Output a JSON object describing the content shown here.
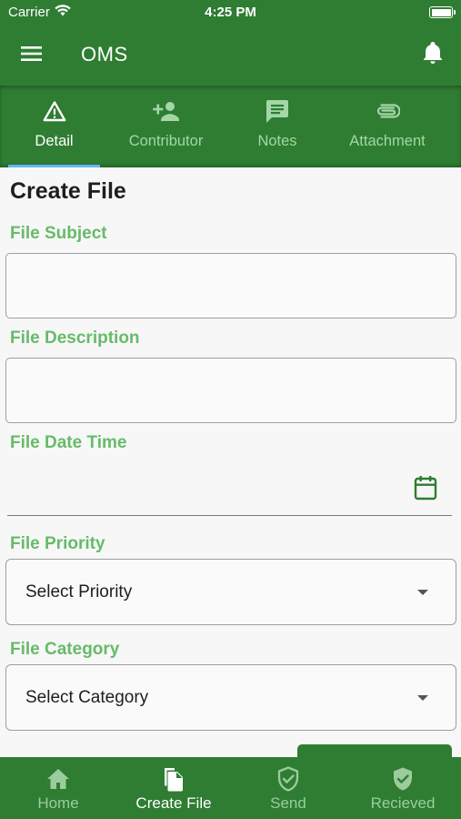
{
  "status_bar": {
    "carrier": "Carrier",
    "time": "4:25 PM"
  },
  "app_bar": {
    "title": "OMS"
  },
  "tabs": [
    {
      "label": "Detail",
      "icon": "warning-icon",
      "active": true
    },
    {
      "label": "Contributor",
      "icon": "person-add-icon",
      "active": false
    },
    {
      "label": "Notes",
      "icon": "comment-icon",
      "active": false
    },
    {
      "label": "Attachment",
      "icon": "paperclip-icon",
      "active": false
    }
  ],
  "form": {
    "title": "Create File",
    "subject_label": "File Subject",
    "subject_value": "",
    "description_label": "File Description",
    "description_value": "",
    "datetime_label": "File Date Time",
    "datetime_value": "",
    "priority_label": "File Priority",
    "priority_value": "Select Priority",
    "category_label": "File Category",
    "category_value": "Select Category"
  },
  "bottom_nav": [
    {
      "label": "Home",
      "icon": "home-icon",
      "active": false
    },
    {
      "label": "Create File",
      "icon": "file-copy-icon",
      "active": true
    },
    {
      "label": "Send",
      "icon": "shield-check-outline-icon",
      "active": false
    },
    {
      "label": "Recieved",
      "icon": "shield-check-filled-icon",
      "active": false
    }
  ],
  "colors": {
    "primary": "#2e7d32",
    "label_green": "#66bb6a",
    "inactive_tab": "#a5d6a7",
    "indicator": "#64b5f6"
  }
}
